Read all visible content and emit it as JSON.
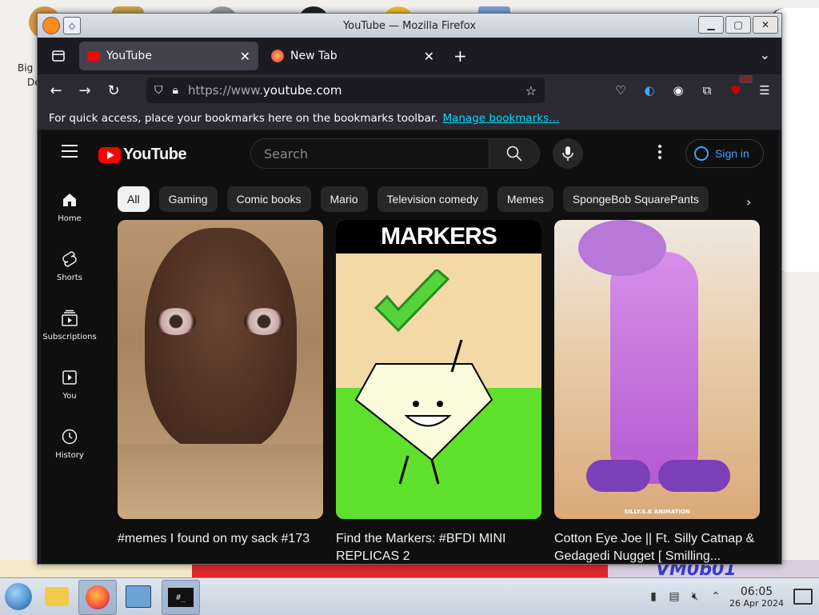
{
  "desktop": {
    "icon_label_line1": "Big",
    "icon_label_line2": "De",
    "watermark": "VM0b01"
  },
  "window": {
    "title": "YouTube — Mozilla Firefox",
    "controls": [
      "minimize",
      "maximize",
      "close"
    ]
  },
  "tabs": [
    {
      "label": "YouTube",
      "active": true
    },
    {
      "label": "New Tab",
      "active": false
    }
  ],
  "navbar": {
    "url_protocol": "https://www.",
    "url_host": "youtube.com",
    "extension_badge": "16"
  },
  "bookmarks_bar": {
    "message": "For quick access, place your bookmarks here on the bookmarks toolbar.",
    "link": "Manage bookmarks…"
  },
  "youtube": {
    "logo_text": "YouTube",
    "search_placeholder": "Search",
    "sign_in": "Sign in",
    "guide": [
      {
        "label": "Home",
        "icon": "home-icon"
      },
      {
        "label": "Shorts",
        "icon": "shorts-icon"
      },
      {
        "label": "Subscriptions",
        "icon": "subscriptions-icon"
      },
      {
        "label": "You",
        "icon": "you-icon"
      },
      {
        "label": "History",
        "icon": "history-icon"
      }
    ],
    "chips": [
      "All",
      "Gaming",
      "Comic books",
      "Mario",
      "Television comedy",
      "Memes",
      "SpongeBob SquarePants"
    ],
    "videos": [
      {
        "title": "#memes I found on my sack #173"
      },
      {
        "title": "Find the Markers: #BFDI MINI REPLICAS 2",
        "thumb_text": "MARKERS"
      },
      {
        "title": "Cotton Eye Joe || Ft. Silly Catnap & Gedagedi Nugget [ Smilling...",
        "thumb_text": "SILLY.S.K ANIMATION"
      }
    ]
  },
  "taskbar": {
    "time": "06:05",
    "date": "26 Apr 2024",
    "terminal_label": "#_"
  },
  "colors": {
    "yt_bg": "#0f0f0f",
    "yt_red": "#ff0000",
    "link_blue": "#3ea6ff",
    "firefox_bg": "#1c1b22"
  }
}
